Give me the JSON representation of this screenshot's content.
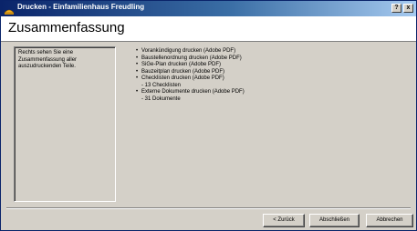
{
  "window": {
    "title": "Drucken - Einfamilienhaus Freudling",
    "help_button": "?",
    "close_button": "x"
  },
  "header": {
    "title": "Zusammenfassung"
  },
  "left_panel": {
    "lines": [
      "Rechts sehen Sie eine",
      "Zusammenfassung aller",
      "auszudruckenden Teile."
    ]
  },
  "summary": {
    "bullet": "•",
    "items": [
      {
        "label": "Vorankündigung drucken (Adobe PDF)"
      },
      {
        "label": "Baustellenordnung drucken (Adobe PDF)"
      },
      {
        "label": "SiGe-Plan drucken (Adobe PDF)"
      },
      {
        "label": "Bauzeitplan drucken (Adobe PDF)"
      },
      {
        "label": "Checklisten drucken (Adobe PDF)",
        "detail": "- 13 Checklisten"
      },
      {
        "label": "Externe Dokumente drucken (Adobe PDF)",
        "detail": "- 31 Dokumente"
      }
    ]
  },
  "buttons": {
    "back": "< Zurück",
    "finish": "Abschließen",
    "cancel": "Abbrechen"
  }
}
